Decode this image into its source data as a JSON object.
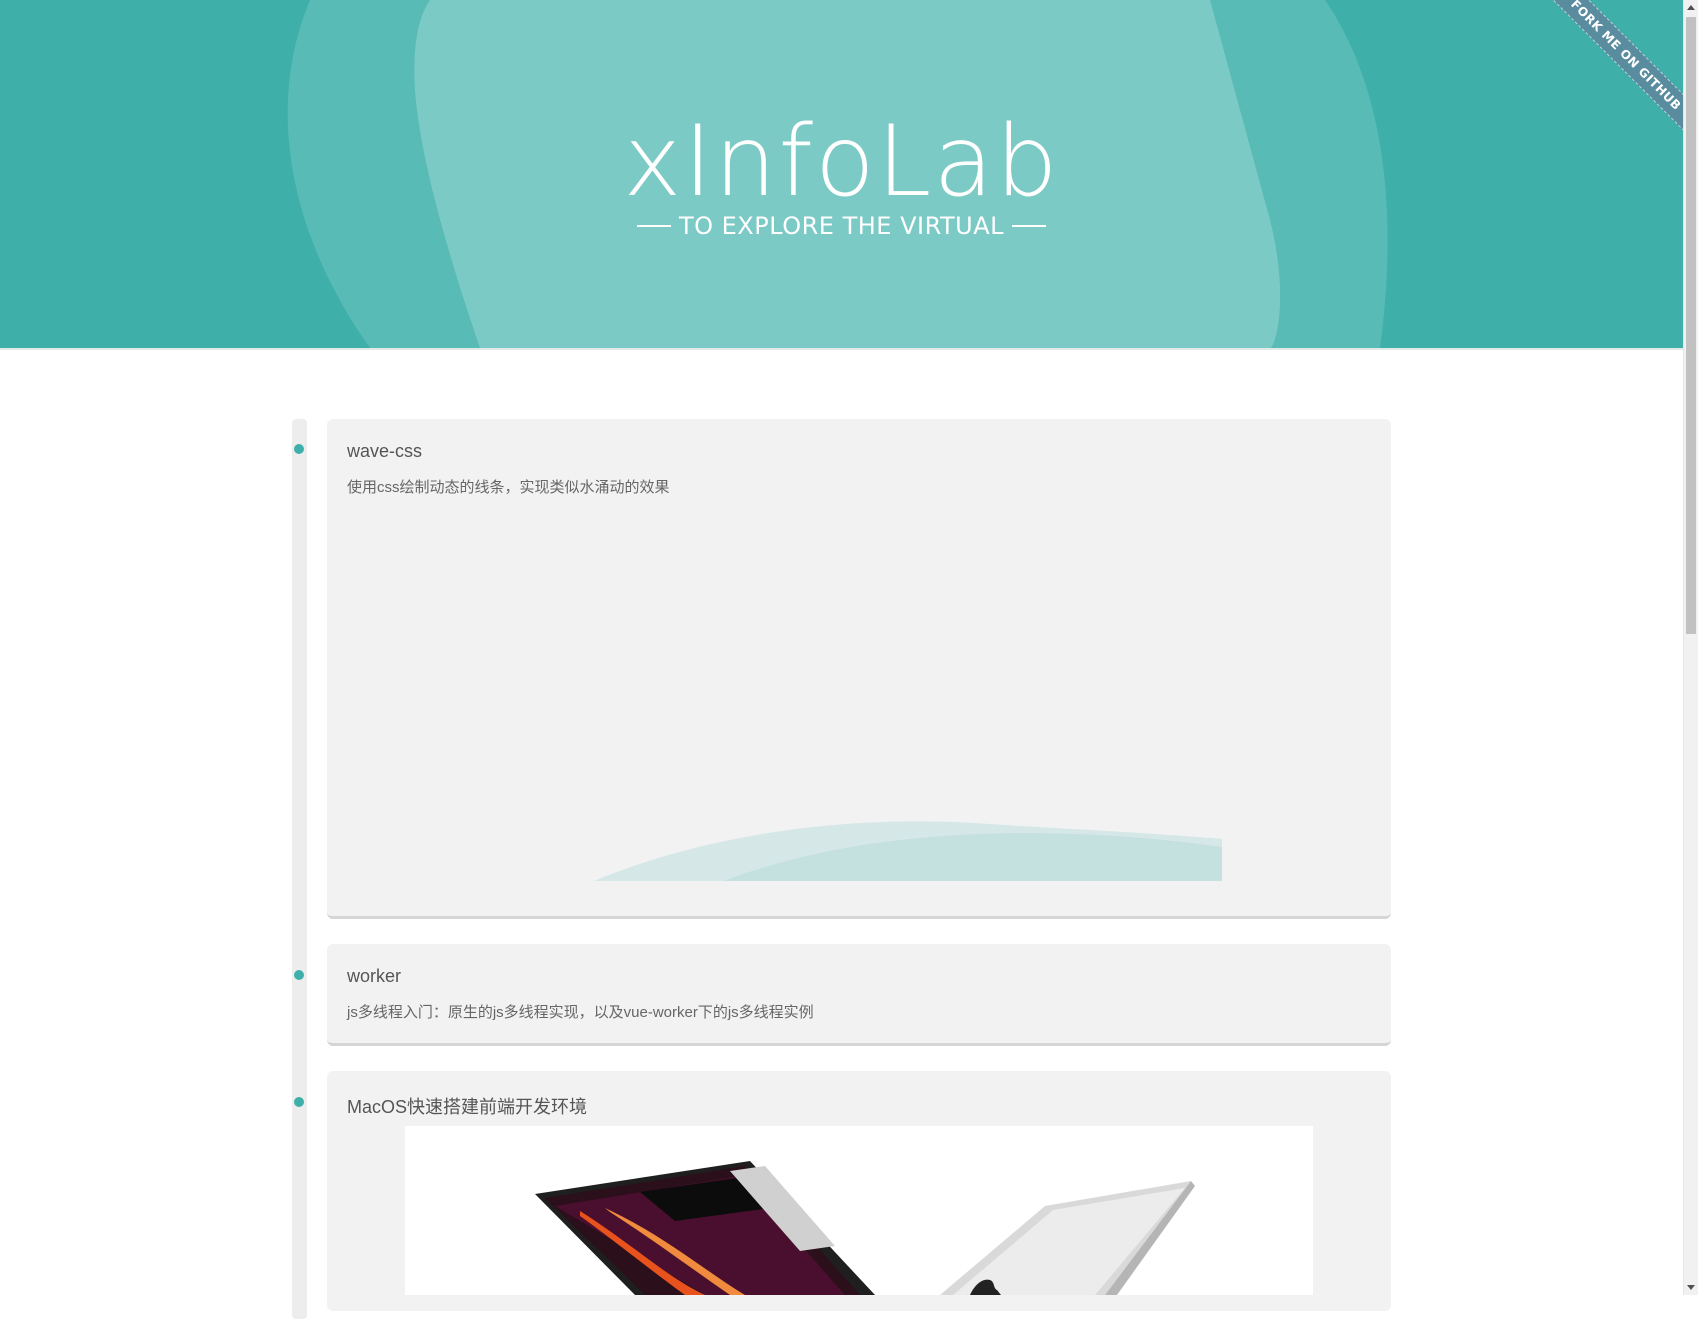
{
  "header": {
    "logo_text": "xInfoLab",
    "tagline": "TO EXPLORE THE VIRTUAL",
    "ribbon_label": "FORK ME ON GITHUB",
    "colors": {
      "primary": "#3eafa9",
      "blob_light": "#7ccac6",
      "blob_mid": "#59bbb6",
      "ribbon": "#5a8ca0"
    }
  },
  "timeline": {
    "items": [
      {
        "title": "wave-css",
        "description": "使用css绘制动态的线条，实现类似水涌动的效果"
      },
      {
        "title": "worker",
        "description": "js多线程入门：原生的js多线程实现，以及vue-worker下的js多线程实例"
      },
      {
        "title": "MacOS快速搭建前端开发环境",
        "description": ""
      }
    ]
  }
}
